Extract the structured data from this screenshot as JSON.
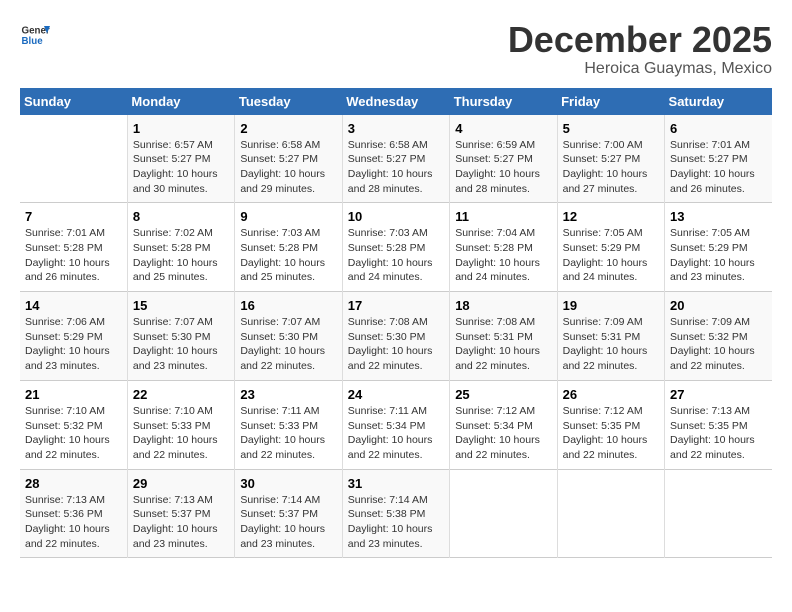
{
  "logo": {
    "general": "General",
    "blue": "Blue"
  },
  "title": {
    "month": "December 2025",
    "location": "Heroica Guaymas, Mexico"
  },
  "headers": [
    "Sunday",
    "Monday",
    "Tuesday",
    "Wednesday",
    "Thursday",
    "Friday",
    "Saturday"
  ],
  "weeks": [
    [
      {
        "day": "",
        "info": ""
      },
      {
        "day": "1",
        "info": "Sunrise: 6:57 AM\nSunset: 5:27 PM\nDaylight: 10 hours\nand 30 minutes."
      },
      {
        "day": "2",
        "info": "Sunrise: 6:58 AM\nSunset: 5:27 PM\nDaylight: 10 hours\nand 29 minutes."
      },
      {
        "day": "3",
        "info": "Sunrise: 6:58 AM\nSunset: 5:27 PM\nDaylight: 10 hours\nand 28 minutes."
      },
      {
        "day": "4",
        "info": "Sunrise: 6:59 AM\nSunset: 5:27 PM\nDaylight: 10 hours\nand 28 minutes."
      },
      {
        "day": "5",
        "info": "Sunrise: 7:00 AM\nSunset: 5:27 PM\nDaylight: 10 hours\nand 27 minutes."
      },
      {
        "day": "6",
        "info": "Sunrise: 7:01 AM\nSunset: 5:27 PM\nDaylight: 10 hours\nand 26 minutes."
      }
    ],
    [
      {
        "day": "7",
        "info": "Sunrise: 7:01 AM\nSunset: 5:28 PM\nDaylight: 10 hours\nand 26 minutes."
      },
      {
        "day": "8",
        "info": "Sunrise: 7:02 AM\nSunset: 5:28 PM\nDaylight: 10 hours\nand 25 minutes."
      },
      {
        "day": "9",
        "info": "Sunrise: 7:03 AM\nSunset: 5:28 PM\nDaylight: 10 hours\nand 25 minutes."
      },
      {
        "day": "10",
        "info": "Sunrise: 7:03 AM\nSunset: 5:28 PM\nDaylight: 10 hours\nand 24 minutes."
      },
      {
        "day": "11",
        "info": "Sunrise: 7:04 AM\nSunset: 5:28 PM\nDaylight: 10 hours\nand 24 minutes."
      },
      {
        "day": "12",
        "info": "Sunrise: 7:05 AM\nSunset: 5:29 PM\nDaylight: 10 hours\nand 24 minutes."
      },
      {
        "day": "13",
        "info": "Sunrise: 7:05 AM\nSunset: 5:29 PM\nDaylight: 10 hours\nand 23 minutes."
      }
    ],
    [
      {
        "day": "14",
        "info": "Sunrise: 7:06 AM\nSunset: 5:29 PM\nDaylight: 10 hours\nand 23 minutes."
      },
      {
        "day": "15",
        "info": "Sunrise: 7:07 AM\nSunset: 5:30 PM\nDaylight: 10 hours\nand 23 minutes."
      },
      {
        "day": "16",
        "info": "Sunrise: 7:07 AM\nSunset: 5:30 PM\nDaylight: 10 hours\nand 22 minutes."
      },
      {
        "day": "17",
        "info": "Sunrise: 7:08 AM\nSunset: 5:30 PM\nDaylight: 10 hours\nand 22 minutes."
      },
      {
        "day": "18",
        "info": "Sunrise: 7:08 AM\nSunset: 5:31 PM\nDaylight: 10 hours\nand 22 minutes."
      },
      {
        "day": "19",
        "info": "Sunrise: 7:09 AM\nSunset: 5:31 PM\nDaylight: 10 hours\nand 22 minutes."
      },
      {
        "day": "20",
        "info": "Sunrise: 7:09 AM\nSunset: 5:32 PM\nDaylight: 10 hours\nand 22 minutes."
      }
    ],
    [
      {
        "day": "21",
        "info": "Sunrise: 7:10 AM\nSunset: 5:32 PM\nDaylight: 10 hours\nand 22 minutes."
      },
      {
        "day": "22",
        "info": "Sunrise: 7:10 AM\nSunset: 5:33 PM\nDaylight: 10 hours\nand 22 minutes."
      },
      {
        "day": "23",
        "info": "Sunrise: 7:11 AM\nSunset: 5:33 PM\nDaylight: 10 hours\nand 22 minutes."
      },
      {
        "day": "24",
        "info": "Sunrise: 7:11 AM\nSunset: 5:34 PM\nDaylight: 10 hours\nand 22 minutes."
      },
      {
        "day": "25",
        "info": "Sunrise: 7:12 AM\nSunset: 5:34 PM\nDaylight: 10 hours\nand 22 minutes."
      },
      {
        "day": "26",
        "info": "Sunrise: 7:12 AM\nSunset: 5:35 PM\nDaylight: 10 hours\nand 22 minutes."
      },
      {
        "day": "27",
        "info": "Sunrise: 7:13 AM\nSunset: 5:35 PM\nDaylight: 10 hours\nand 22 minutes."
      }
    ],
    [
      {
        "day": "28",
        "info": "Sunrise: 7:13 AM\nSunset: 5:36 PM\nDaylight: 10 hours\nand 22 minutes."
      },
      {
        "day": "29",
        "info": "Sunrise: 7:13 AM\nSunset: 5:37 PM\nDaylight: 10 hours\nand 23 minutes."
      },
      {
        "day": "30",
        "info": "Sunrise: 7:14 AM\nSunset: 5:37 PM\nDaylight: 10 hours\nand 23 minutes."
      },
      {
        "day": "31",
        "info": "Sunrise: 7:14 AM\nSunset: 5:38 PM\nDaylight: 10 hours\nand 23 minutes."
      },
      {
        "day": "",
        "info": ""
      },
      {
        "day": "",
        "info": ""
      },
      {
        "day": "",
        "info": ""
      }
    ]
  ]
}
